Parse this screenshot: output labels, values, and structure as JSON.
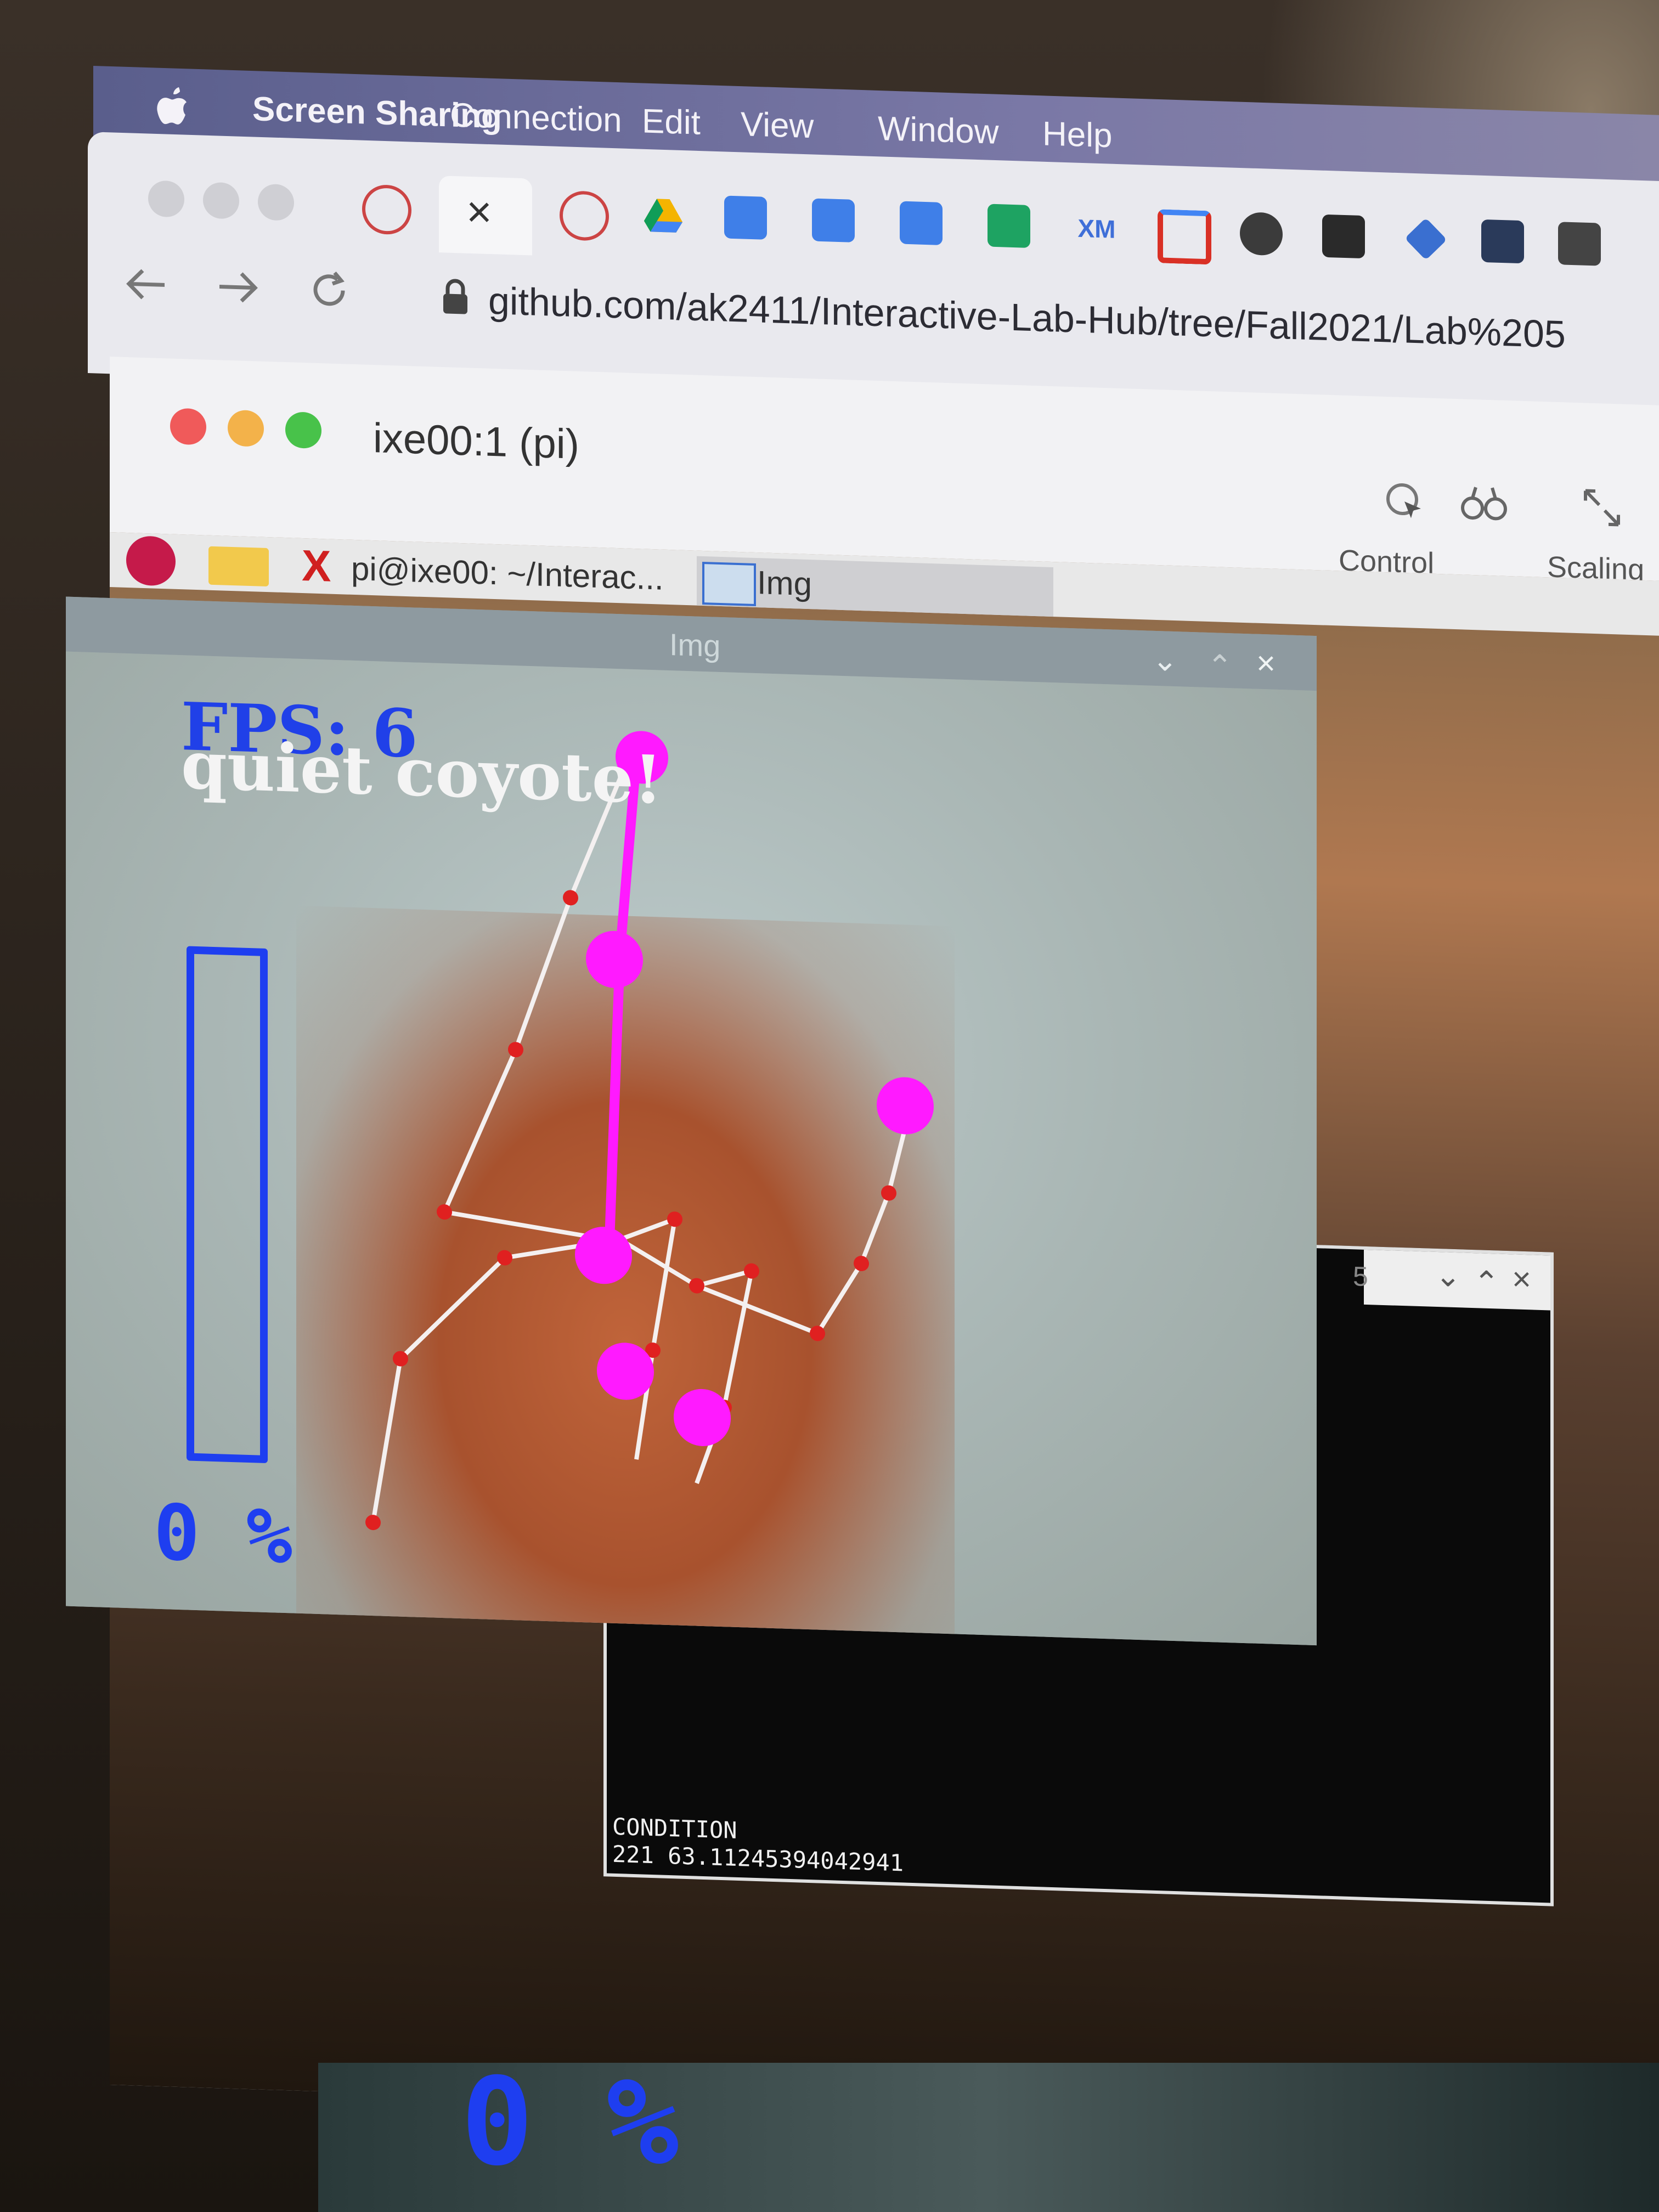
{
  "menubar": {
    "items": [
      "Screen Sharing",
      "Connection",
      "Edit",
      "View",
      "Window",
      "Help"
    ]
  },
  "browser": {
    "url": "github.com/ak2411/Interactive-Lab-Hub/tree/Fall2021/Lab%205",
    "tab_close": "×",
    "tab_xm_label": "XM"
  },
  "vnc": {
    "title": "ixe00:1 (pi)",
    "control_label": "Control",
    "scaling_label": "Scaling"
  },
  "pi_taskbar": {
    "terminal_task": "pi@ixe00: ~/Interac...",
    "img_task": "Img"
  },
  "img_window": {
    "title": "Img",
    "fps_text": "FPS: 6",
    "gesture_text": "quiet coyote!",
    "volume_percent": "0 %",
    "volume_level": 0
  },
  "terminal": {
    "title_number": "5",
    "line1": "CONDITION",
    "line2": "221 63.11245394042941"
  },
  "bottom_overlay": {
    "percent": "0 %"
  },
  "colors": {
    "menubar": "#6a6c98",
    "fps_blue": "#2040e8",
    "landmark_magenta": "#ff1aff",
    "landmark_red": "#e02020"
  }
}
